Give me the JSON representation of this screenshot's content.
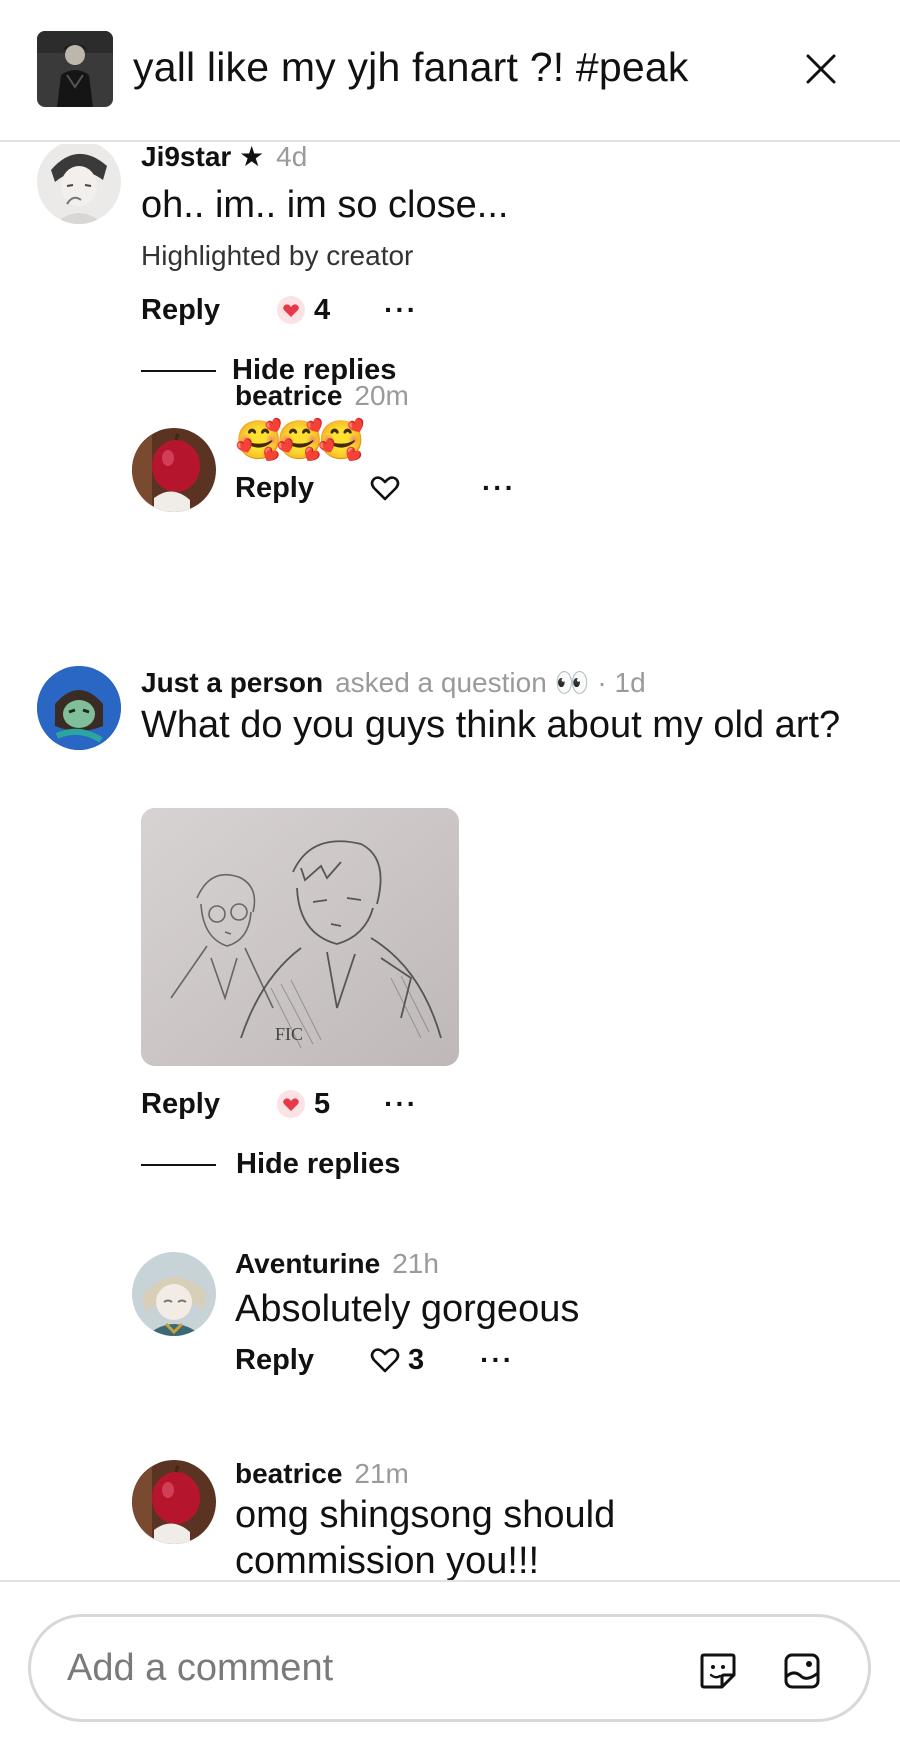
{
  "header": {
    "title": "yall like my yjh fanart ?! #peak",
    "close_icon": "close-icon"
  },
  "comments": [
    {
      "username": "Ji9star ★",
      "time": "4d",
      "text": "oh.. im.. im so close...",
      "highlight": "Highlighted by creator",
      "reply_label": "Reply",
      "likes": "4",
      "liked": true,
      "more": "···",
      "hide_replies": "Hide replies",
      "replies": [
        {
          "username": "beatrice",
          "time": "20m",
          "text": "🥰🥰🥰",
          "reply_label": "Reply",
          "likes": "",
          "more": "···"
        }
      ]
    },
    {
      "username": "Just a person",
      "asked": "asked a question 👀",
      "time": "· 1d",
      "text": "What do you guys think about my old art?",
      "image_signature": "FIC",
      "reply_label": "Reply",
      "likes": "5",
      "liked": true,
      "more": "···",
      "hide_replies": "Hide replies",
      "replies": [
        {
          "username": "Aventurine",
          "time": "21h",
          "text": "Absolutely gorgeous",
          "reply_label": "Reply",
          "likes": "3",
          "more": "···"
        },
        {
          "username": "beatrice",
          "time": "21m",
          "text": "omg shingsong should commission you!!!"
        }
      ]
    }
  ],
  "composer": {
    "placeholder": "Add a comment",
    "sticker_icon": "sticker-icon",
    "image_icon": "image-icon"
  },
  "colors": {
    "like_heart": "#e8394a",
    "muted": "#9a9a9a",
    "divider": "#e2e2e2"
  }
}
